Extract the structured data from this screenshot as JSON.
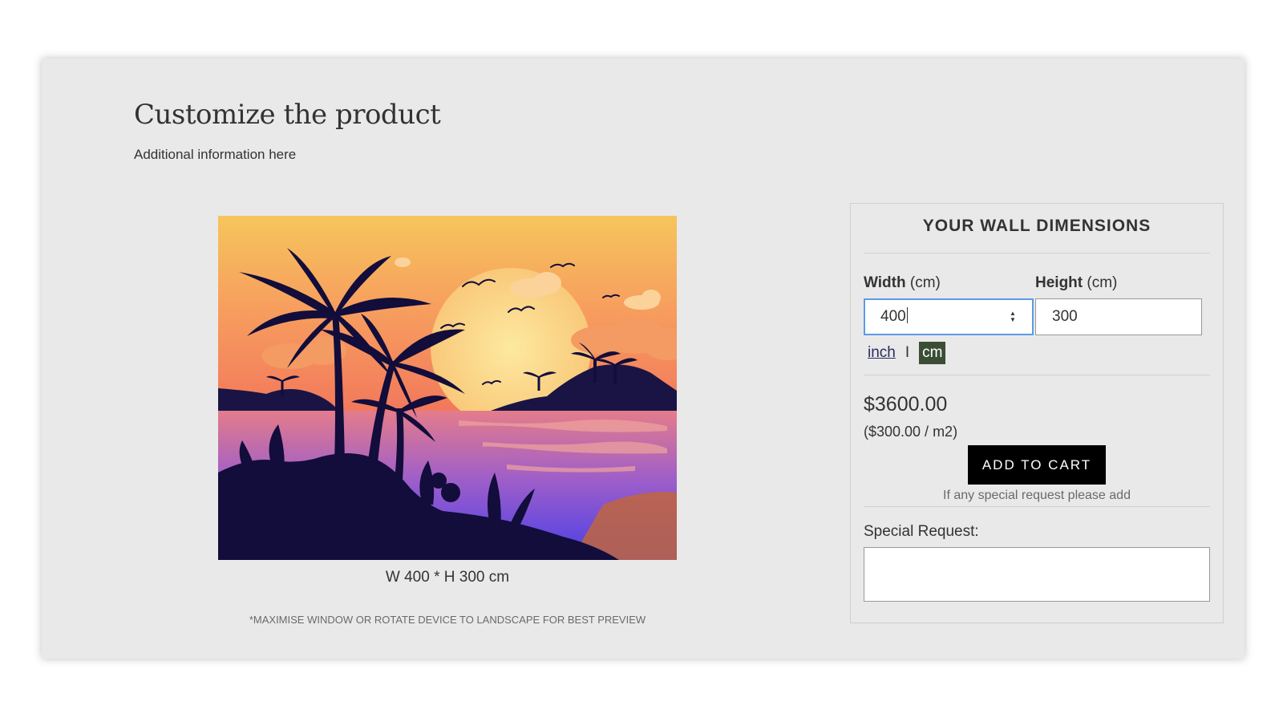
{
  "page": {
    "title": "Customize the product",
    "subtitle": "Additional information here"
  },
  "preview": {
    "image_icon": "tropical-sunset-wallpaper",
    "dimensions_caption": "W 400 * H 300 cm",
    "note": "*MAXIMISE WINDOW OR ROTATE DEVICE TO LANDSCAPE FOR BEST PREVIEW"
  },
  "panel": {
    "title": "YOUR WALL DIMENSIONS",
    "width": {
      "label_bold": "Width",
      "label_unit": "(cm)",
      "value": "400"
    },
    "height": {
      "label_bold": "Height",
      "label_unit": "(cm)",
      "value": "300"
    },
    "units": {
      "inch": "inch",
      "separator": "I",
      "cm": "cm",
      "selected": "cm"
    },
    "price": "$3600.00",
    "rate": "($300.00 / m2)",
    "add_to_cart": "ADD TO CART",
    "hint": "If any special request please add",
    "special_request_label": "Special Request:",
    "special_request_value": ""
  },
  "colors": {
    "card_bg": "#e9e9e9",
    "focus_border": "#5b9be8",
    "unit_selected_bg": "#3b4e35",
    "cart_button_bg": "#000000"
  }
}
